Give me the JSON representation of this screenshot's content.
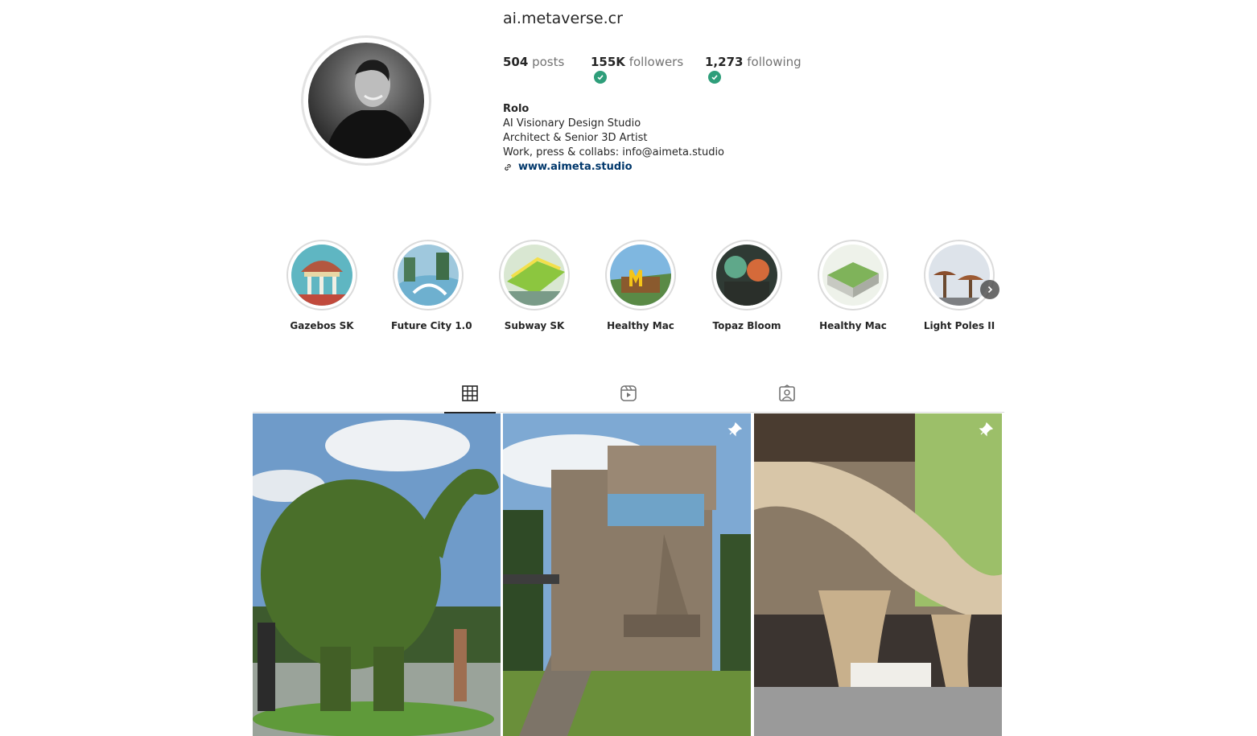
{
  "profile": {
    "username": "ai.metaverse.cr",
    "stats": {
      "posts_count": "504",
      "posts_label": "posts",
      "followers_count": "155K",
      "followers_label": "followers",
      "following_count": "1,273",
      "following_label": "following"
    },
    "bio": {
      "name": "Rolo",
      "line1": "AI Visionary Design Studio",
      "line2": "Architect & Senior 3D Artist",
      "line3": "Work, press & collabs: info@aimeta.studio",
      "link": "www.aimeta.studio"
    }
  },
  "highlights": [
    {
      "label": "Gazebos SK"
    },
    {
      "label": "Future City 1.0"
    },
    {
      "label": "Subway SK"
    },
    {
      "label": "Healthy Mac"
    },
    {
      "label": "Topaz Bloom"
    },
    {
      "label": "Healthy Mac"
    },
    {
      "label": "Light Poles II"
    }
  ],
  "tabs": [
    {
      "icon": "grid-icon",
      "active": true
    },
    {
      "icon": "reels-icon",
      "active": false
    },
    {
      "icon": "tagged-icon",
      "active": false
    }
  ],
  "posts": [
    {
      "subject": "topiary-dinosaur",
      "pinned": false
    },
    {
      "subject": "moai-house",
      "pinned": true
    },
    {
      "subject": "tree-canopy-building",
      "pinned": true
    }
  ],
  "colors": {
    "check": "#2e9e7a",
    "link": "#00376b",
    "text": "#262626",
    "muted": "#737373"
  }
}
